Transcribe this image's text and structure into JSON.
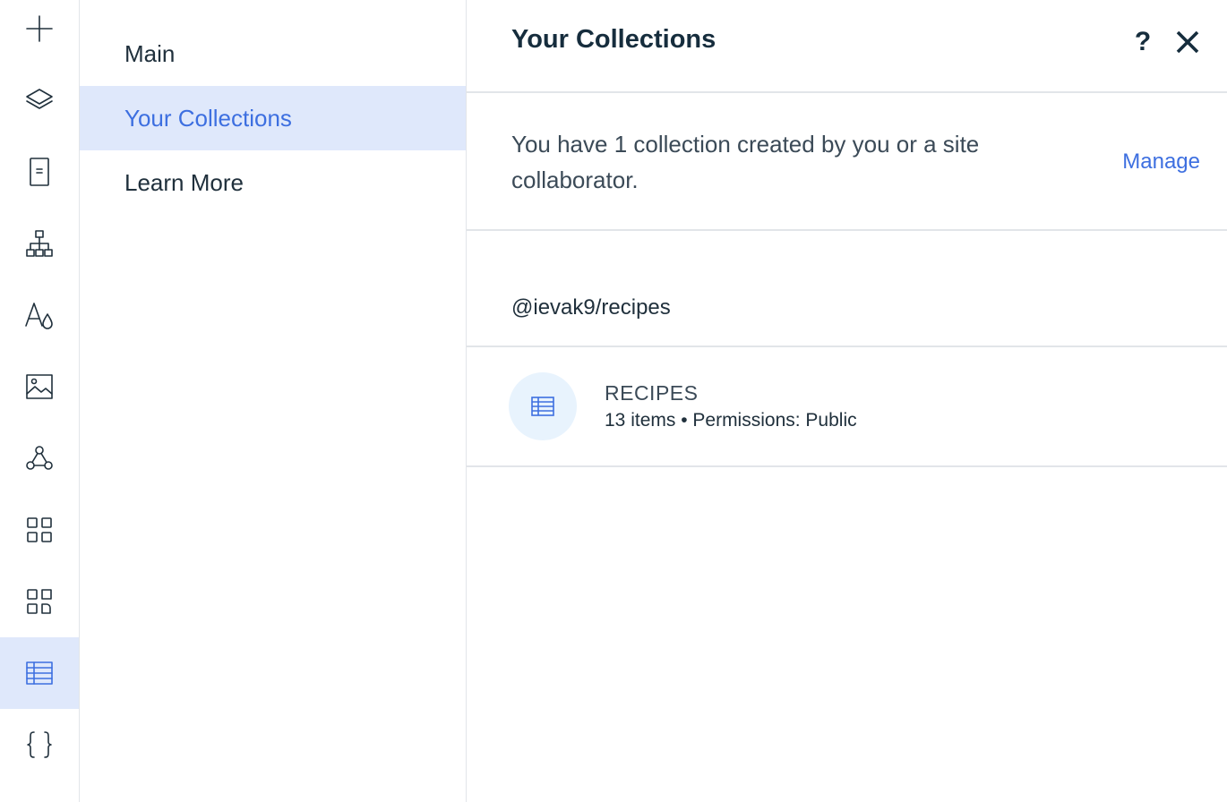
{
  "rail": {
    "items": [
      {
        "icon": "add-icon"
      },
      {
        "icon": "layers-icon"
      },
      {
        "icon": "page-icon"
      },
      {
        "icon": "sitemap-icon"
      },
      {
        "icon": "theme-icon"
      },
      {
        "icon": "media-icon"
      },
      {
        "icon": "connections-icon"
      },
      {
        "icon": "apps-icon"
      },
      {
        "icon": "app-extension-icon"
      },
      {
        "icon": "cms-table-icon",
        "active": true
      },
      {
        "icon": "code-braces-icon"
      }
    ]
  },
  "menu": {
    "items": [
      {
        "label": "Main"
      },
      {
        "label": "Your Collections",
        "active": true
      },
      {
        "label": "Learn More"
      }
    ]
  },
  "panel": {
    "title": "Your Collections",
    "help_label": "?",
    "info_text": "You have 1 collection created by you or a site collaborator.",
    "manage_label": "Manage",
    "namespace": "@ievak9/recipes",
    "collection": {
      "name": "RECIPES",
      "meta": "13 items • Permissions: Public",
      "icon": "table-icon"
    }
  },
  "colors": {
    "accent": "#3d6fe0",
    "active_bg": "#dfe8fb",
    "icon_circle_bg": "#e8f3fd",
    "divider": "#e2e5e9"
  }
}
